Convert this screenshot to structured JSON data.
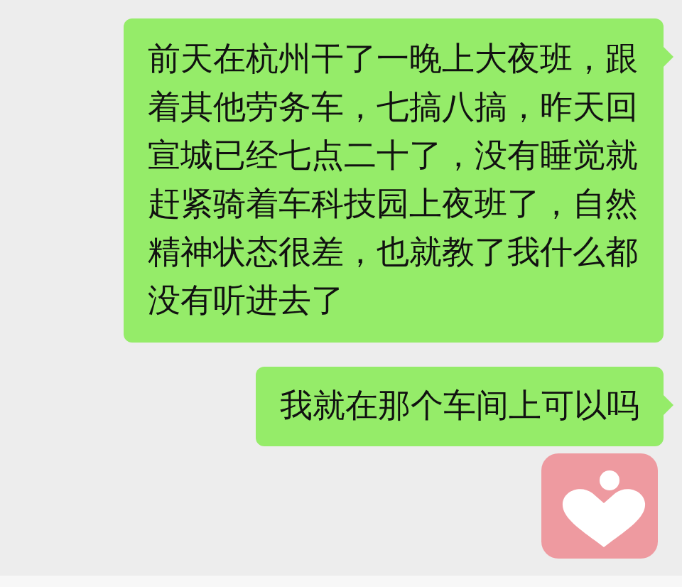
{
  "messages": [
    {
      "kind": "text",
      "text": "前天在杭州干了一晚上大夜班，跟着其他劳务车，七搞八搞，昨天回宣城已经七点二十了，没有睡觉就赶紧骑着车科技园上夜班了，自然精神状态很差，也就教了我什么都没有听进去了"
    },
    {
      "kind": "text",
      "text": "我就在那个车间上可以吗"
    },
    {
      "kind": "sticker"
    }
  ]
}
